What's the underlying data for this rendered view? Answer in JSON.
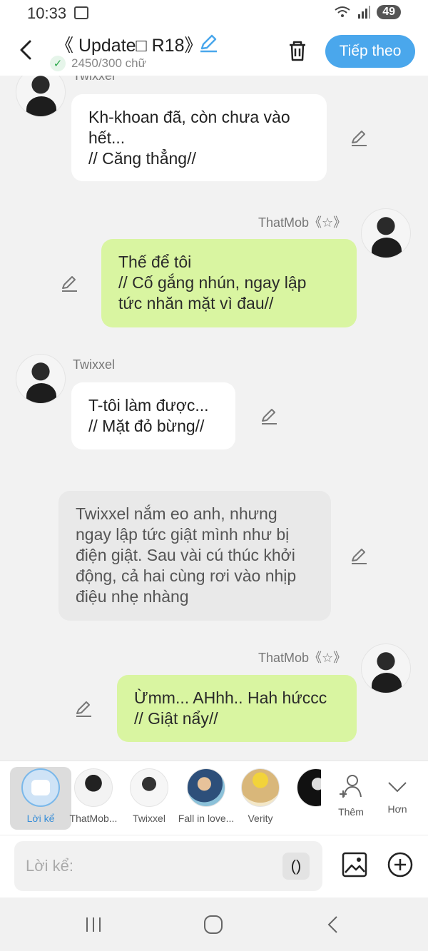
{
  "status_bar": {
    "time": "10:33",
    "battery": "49"
  },
  "header": {
    "title": "《 Update□ R18》",
    "subtitle": "2450/300 chữ",
    "next_label": "Tiếp theo"
  },
  "messages": [
    {
      "speaker": "Twixxel",
      "side": "left",
      "text": "Kh-khoan đã, còn chưa vào\nhết...\n// Căng thẳng//"
    },
    {
      "speaker": "ThatMob《☆》",
      "side": "right",
      "text": "Thế để tôi\n// Cố gắng nhún, ngay lập\ntức nhăn mặt vì đau//"
    },
    {
      "speaker": "Twixxel",
      "side": "left",
      "text": "T-tôi làm được...\n// Mặt đỏ bừng//"
    },
    {
      "speaker": "",
      "side": "narration",
      "text": "Twixxel nắm eo anh, nhưng\nngay lập tức giật mình như bị\nđiện giật. Sau vài cú thúc khởi\nđộng, cả hai cùng rơi vào nhịp\nđiệu nhẹ nhàng"
    },
    {
      "speaker": "ThatMob《☆》",
      "side": "right",
      "text": "Ừmm... AHhh.. Hah hứccc\n// Giật nẩy//"
    }
  ],
  "characters": [
    {
      "label": "Lời kể",
      "active": true
    },
    {
      "label": "ThatMob..."
    },
    {
      "label": "Twixxel"
    },
    {
      "label": "Fall in love..."
    },
    {
      "label": "Verity"
    },
    {
      "label": ""
    }
  ],
  "char_actions": {
    "more_label": "Thêm",
    "expand_label": "Hơn"
  },
  "input": {
    "placeholder": "Lời kể:",
    "paren_label": "()"
  },
  "colors": {
    "accent": "#4aa7ec",
    "green_bubble": "#d9f5a1",
    "narration_bubble": "#e9e9e9"
  }
}
